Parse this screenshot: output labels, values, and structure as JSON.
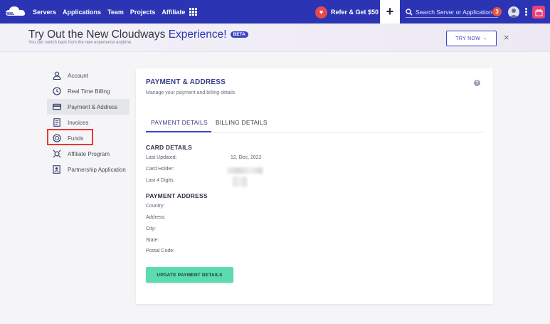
{
  "topbar": {
    "nav": [
      "Servers",
      "Applications",
      "Team",
      "Projects",
      "Affiliate"
    ],
    "refer_label": "Refer & Get $50",
    "search_placeholder": "Search Server or Application",
    "notification_count": "3",
    "icons": {
      "logo": "cloud-logo",
      "apps": "grid-icon",
      "refer": "heart-icon",
      "add": "plus-icon",
      "search": "search-icon",
      "avatar": "user-avatar-icon",
      "menu": "kebab-menu-icon",
      "gift": "gift-icon"
    }
  },
  "banner": {
    "title_part1": "Try Out the New Cloudways ",
    "title_accent": "Experience!",
    "beta": "BETA",
    "subtitle": "You can switch back from the new experience anytime.",
    "try_label": "TRY NOW →",
    "close_label": "×"
  },
  "sidebar": {
    "items": [
      {
        "label": "Account",
        "icon": "account-icon",
        "active": false
      },
      {
        "label": "Real Time Billing",
        "icon": "clock-icon",
        "active": false
      },
      {
        "label": "Payment & Address",
        "icon": "credit-card-icon",
        "active": true
      },
      {
        "label": "Invoices",
        "icon": "invoice-icon",
        "active": false
      },
      {
        "label": "Funds",
        "icon": "funds-icon",
        "active": false
      },
      {
        "label": "Affiliate Program",
        "icon": "affiliate-icon",
        "active": false
      },
      {
        "label": "Partnership Application",
        "icon": "partnership-icon",
        "active": false
      }
    ]
  },
  "main": {
    "title": "PAYMENT & ADDRESS",
    "subtitle": "Manage your payment and billing details",
    "help_label": "?",
    "tabs": [
      {
        "label": "PAYMENT DETAILS",
        "active": true
      },
      {
        "label": "BILLING DETAILS",
        "active": false
      }
    ],
    "card_details": {
      "heading": "CARD DETAILS",
      "last_updated_label": "Last Updated:",
      "last_updated_value": "12, Dec, 2022",
      "card_holder_label": "Card Holder:",
      "last4_label": "Last 4 Digits:"
    },
    "payment_address": {
      "heading": "PAYMENT ADDRESS",
      "country_label": "Country:",
      "address_label": "Address:",
      "city_label": "City:",
      "state_label": "State:",
      "postal_label": "Postal Code:"
    },
    "update_button": "UPDATE PAYMENT DETAILS"
  },
  "colors": {
    "topbar": "#2b34b3",
    "accent": "#3a43c4",
    "update_button": "#5bdcaf",
    "highlight": "#e53935",
    "notification": "#e8553f",
    "gift": "#e8407a"
  }
}
